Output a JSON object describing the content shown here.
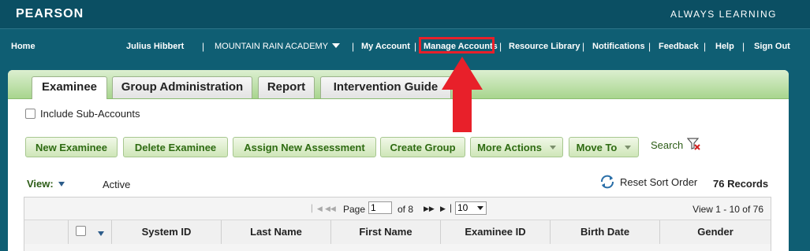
{
  "brand": {
    "logo": "PEARSON",
    "tagline": "ALWAYS LEARNING"
  },
  "nav": {
    "home": "Home",
    "user": "Julius Hibbert",
    "account": "MOUNTAIN RAIN ACADEMY",
    "my_account": "My Account",
    "manage_accounts": "Manage Accounts",
    "resource_library": "Resource Library",
    "notifications": "Notifications",
    "feedback": "Feedback",
    "help": "Help",
    "sign_out": "Sign Out",
    "separator": "|"
  },
  "annotation": {
    "highlight_color": "#e8202a",
    "arrow_color": "#e8202a"
  },
  "tabs": [
    {
      "label": "Examinee",
      "active": true
    },
    {
      "label": "Group Administration",
      "active": false
    },
    {
      "label": "Report",
      "active": false
    },
    {
      "label": "Intervention Guide",
      "active": false
    }
  ],
  "include_sub_accounts": {
    "label": "Include Sub-Accounts",
    "checked": false
  },
  "toolbar": {
    "new_examinee": "New Examinee",
    "delete_examinee": "Delete Examinee",
    "assign_new_assessment": "Assign New Assessment",
    "create_group": "Create Group",
    "more_actions": "More Actions",
    "move_to": "Move To",
    "search": "Search"
  },
  "view": {
    "label": "View:",
    "status": "Active",
    "reset_sort": "Reset Sort Order",
    "records": "76 Records"
  },
  "pager": {
    "page_label": "Page",
    "page": "1",
    "of_label": "of 8",
    "rows": "10",
    "view_info": "View 1 - 10 of 76"
  },
  "columns": [
    "System ID",
    "Last Name",
    "First Name",
    "Examinee ID",
    "Birth Date",
    "Gender"
  ],
  "colors": {
    "top_bar": "#0b4f63",
    "nav_bar": "#0f5e73",
    "panel_header": "#a8d58e",
    "button_text": "#2e6b12"
  }
}
